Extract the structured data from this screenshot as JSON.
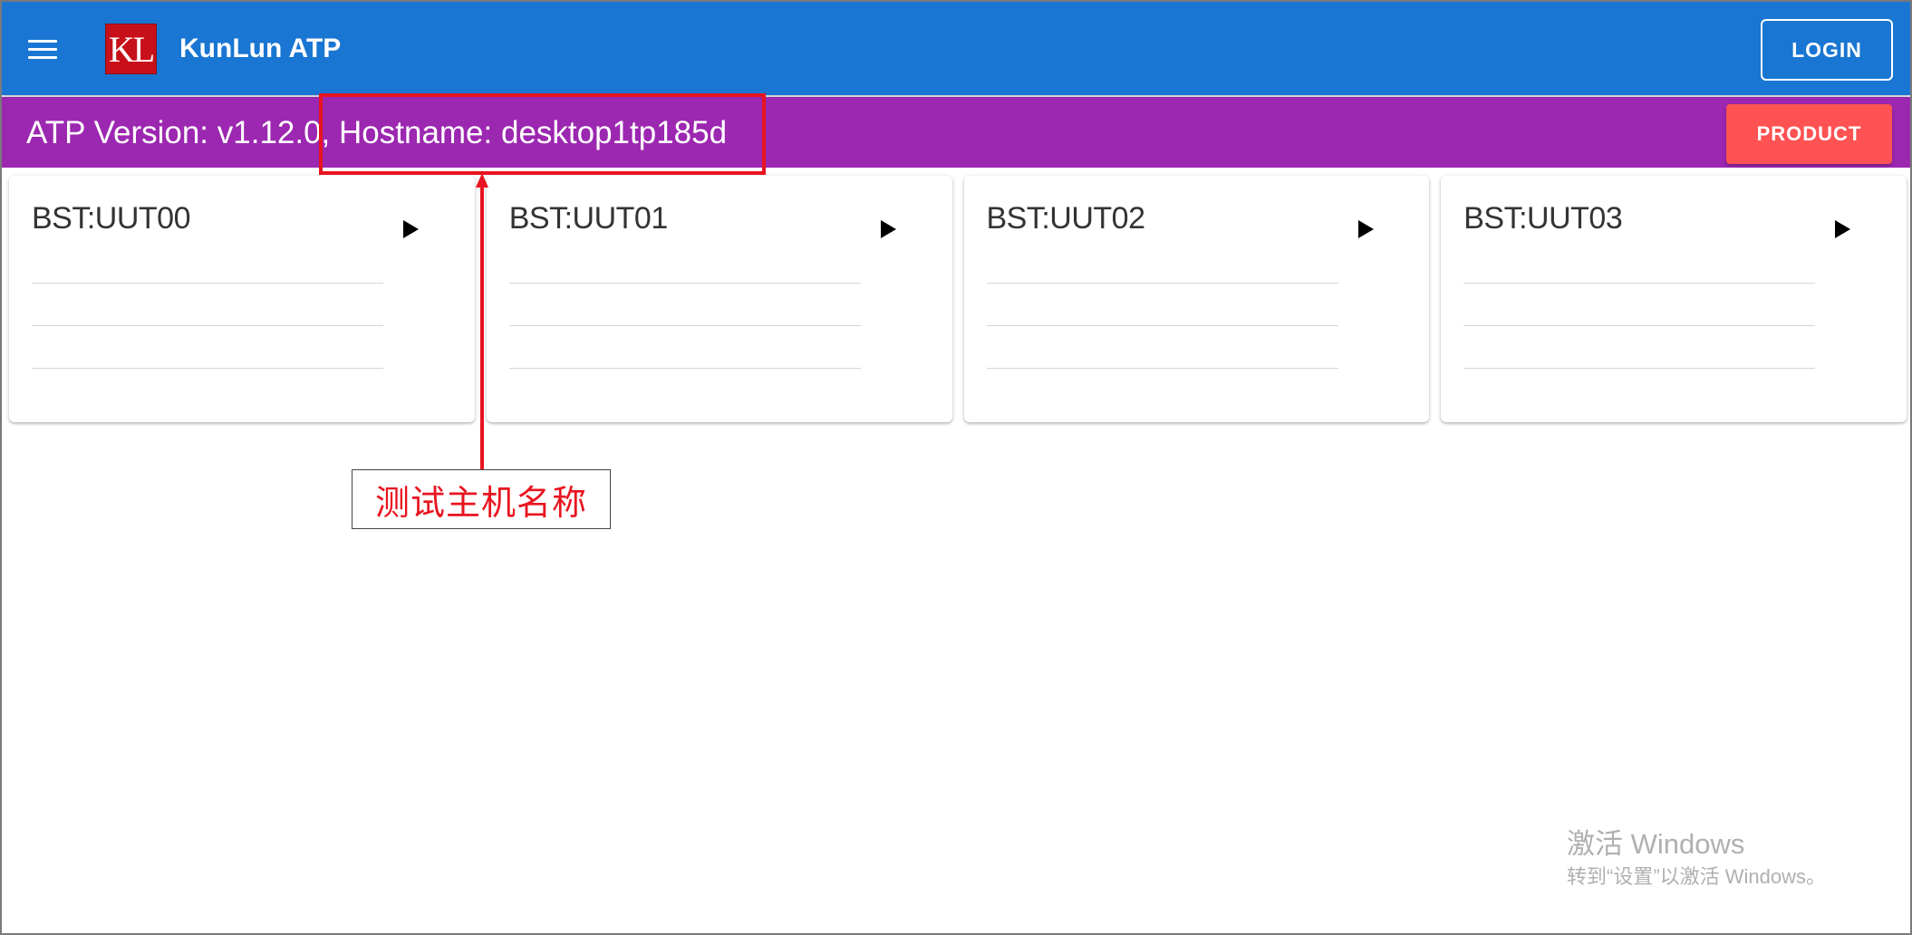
{
  "app_bar": {
    "logo_text": "KL",
    "title": "KunLun ATP",
    "login_label": "LOGIN",
    "colors": {
      "background": "#1976d2",
      "logo": "#c8101a"
    }
  },
  "info_bar": {
    "text": "ATP Version: v1.12.0, Hostname: desktop1tp185d",
    "product_label": "PRODUCT",
    "colors": {
      "background": "#9c27b0",
      "product_button": "#ff5252"
    }
  },
  "cards": [
    {
      "title": "BST:UUT00"
    },
    {
      "title": "BST:UUT01"
    },
    {
      "title": "BST:UUT02"
    },
    {
      "title": "BST:UUT03"
    }
  ],
  "annotation": {
    "label": "测试主机名称",
    "color": "#e8141f"
  },
  "watermark": {
    "title": "激活 Windows",
    "subtitle": "转到“设置”以激活 Windows。"
  },
  "icons": {
    "menu": "menu-icon",
    "play": "play-icon",
    "arrow": "arrow-up-icon"
  }
}
